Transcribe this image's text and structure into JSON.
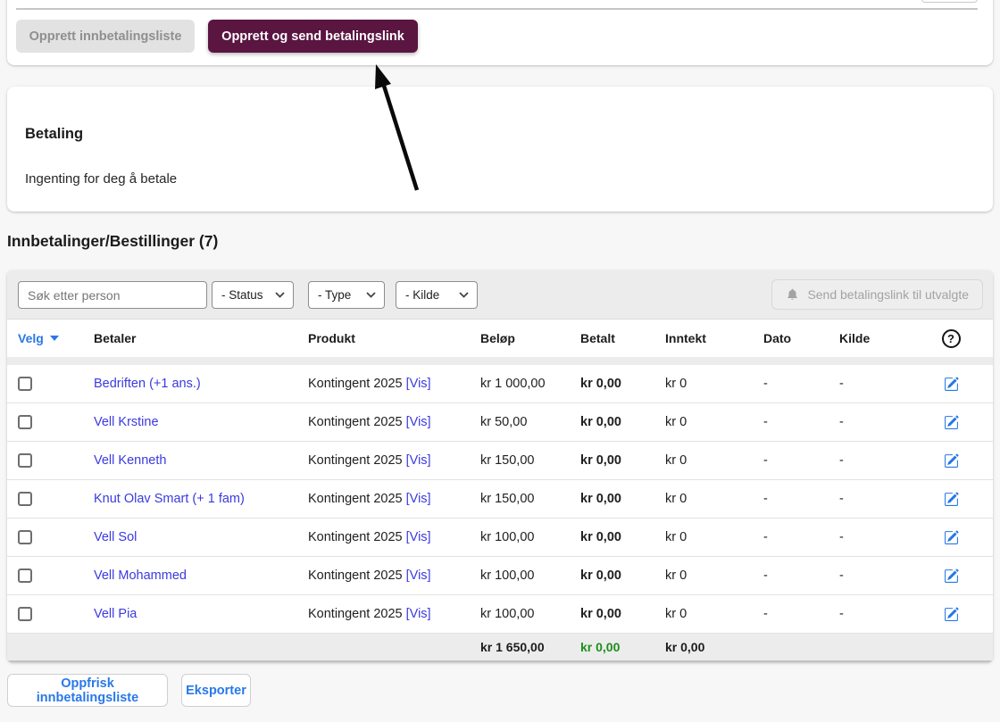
{
  "colors": {
    "accent": "#5a1541",
    "link": "#3a3ae0",
    "action": "#2878e8",
    "green": "#1b8f1b"
  },
  "top_actions": {
    "create_list_label": "Opprett innbetalingsliste",
    "create_send_label": "Opprett og send betalingslink"
  },
  "betaling": {
    "title": "Betaling",
    "body": "Ingenting for deg å betale"
  },
  "section": {
    "title": "Innbetalinger/Bestillinger (7)"
  },
  "filters": {
    "search_placeholder": "Søk etter person",
    "status_value": "- Status",
    "type_value": "- Type",
    "kilde_value": "- Kilde",
    "send_button_label": "Send betalingslink til utvalgte"
  },
  "icons": {
    "bell": "bell-icon",
    "chevron": "chevron-down-icon",
    "sort_caret": "caret-down-icon",
    "help_glyph": "?",
    "edit": "edit-icon"
  },
  "table": {
    "headers": {
      "velg": "Velg",
      "betaler": "Betaler",
      "produkt": "Produkt",
      "belop": "Beløp",
      "betalt": "Betalt",
      "inntekt": "Inntekt",
      "dato": "Dato",
      "kilde": "Kilde"
    },
    "rows": [
      {
        "betaler": "Bedriften (+1 ans.)",
        "produkt": "Kontingent 2025",
        "vis": "[Vis]",
        "belop": "kr 1 000,00",
        "betalt": "kr 0,00",
        "inntekt": "kr 0",
        "dato": "-",
        "kilde": "-"
      },
      {
        "betaler": "Vell Krstine",
        "produkt": "Kontingent 2025",
        "vis": "[Vis]",
        "belop": "kr 50,00",
        "betalt": "kr 0,00",
        "inntekt": "kr 0",
        "dato": "-",
        "kilde": "-"
      },
      {
        "betaler": "Vell Kenneth",
        "produkt": "Kontingent 2025",
        "vis": "[Vis]",
        "belop": "kr 150,00",
        "betalt": "kr 0,00",
        "inntekt": "kr 0",
        "dato": "-",
        "kilde": "-"
      },
      {
        "betaler": "Knut Olav Smart (+ 1 fam)",
        "produkt": "Kontingent 2025",
        "vis": "[Vis]",
        "belop": "kr 150,00",
        "betalt": "kr 0,00",
        "inntekt": "kr 0",
        "dato": "-",
        "kilde": "-"
      },
      {
        "betaler": "Vell Sol",
        "produkt": "Kontingent 2025",
        "vis": "[Vis]",
        "belop": "kr 100,00",
        "betalt": "kr 0,00",
        "inntekt": "kr 0",
        "dato": "-",
        "kilde": "-"
      },
      {
        "betaler": "Vell Mohammed",
        "produkt": "Kontingent 2025",
        "vis": "[Vis]",
        "belop": "kr 100,00",
        "betalt": "kr 0,00",
        "inntekt": "kr 0",
        "dato": "-",
        "kilde": "-"
      },
      {
        "betaler": "Vell Pia",
        "produkt": "Kontingent 2025",
        "vis": "[Vis]",
        "belop": "kr 100,00",
        "betalt": "kr 0,00",
        "inntekt": "kr 0",
        "dato": "-",
        "kilde": "-"
      }
    ],
    "totals": {
      "belop": "kr 1 650,00",
      "betalt": "kr 0,00",
      "inntekt": "kr 0,00"
    }
  },
  "footer": {
    "refresh_label": "Oppfrisk innbetalingsliste",
    "export_label": "Eksporter"
  }
}
